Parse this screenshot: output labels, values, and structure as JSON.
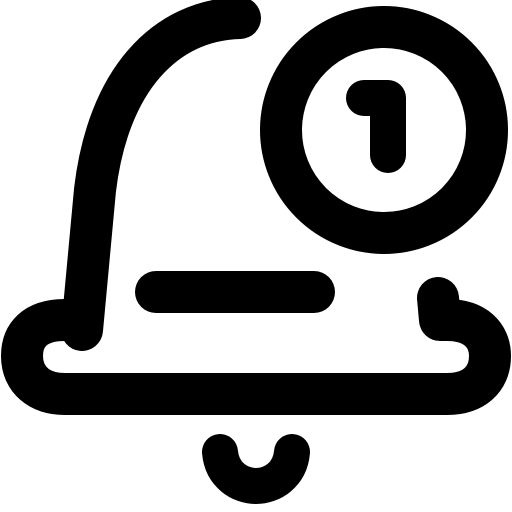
{
  "icon": {
    "name": "notification-bell-icon",
    "badge_count": "1",
    "color": "#000000",
    "background": "#ffffff"
  }
}
